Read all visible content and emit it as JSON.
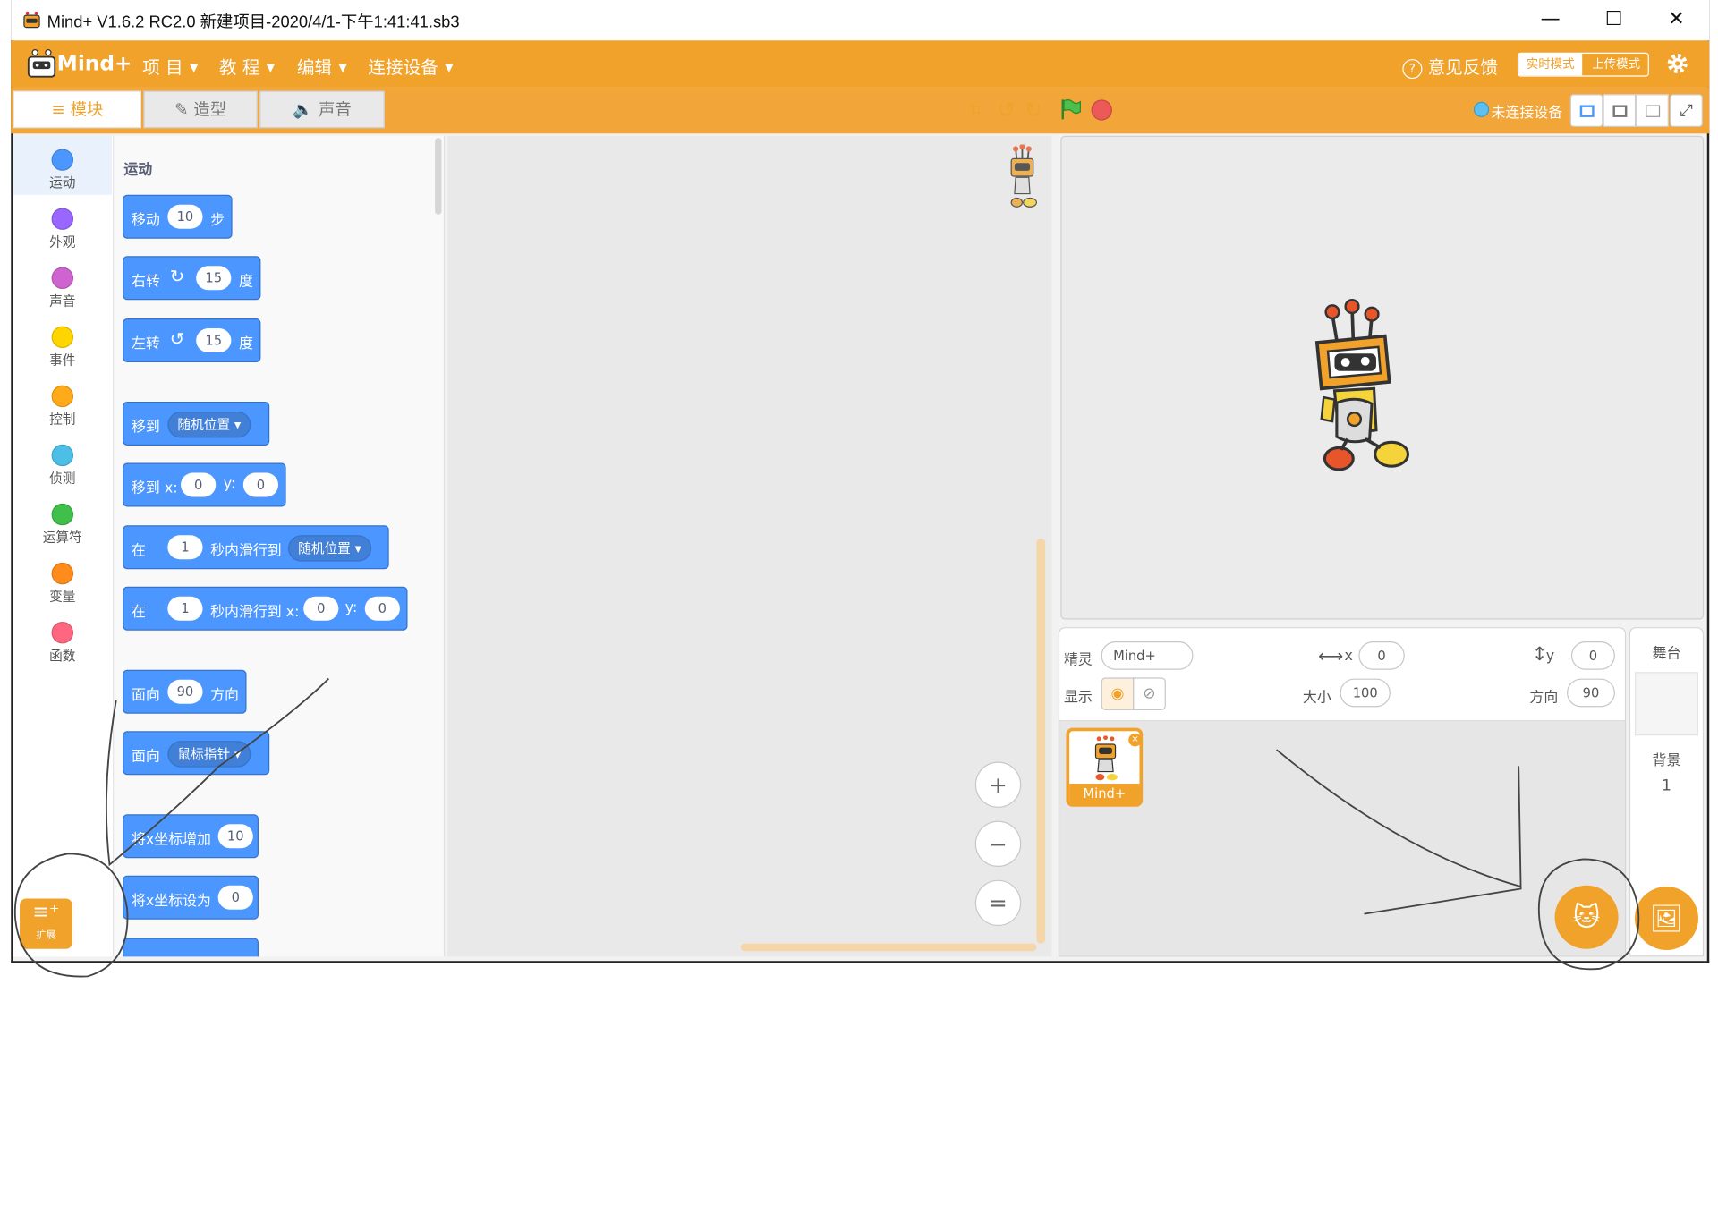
{
  "window": {
    "title": "Mind+ V1.6.2 RC2.0   新建项目-2020/4/1-下午1:41:41.sb3",
    "minimize": "—",
    "maximize": "☐",
    "close": "✕"
  },
  "menubar": {
    "logo": "Mind+",
    "items": [
      {
        "label": "项 目"
      },
      {
        "label": "教 程"
      },
      {
        "label": "编辑"
      },
      {
        "label": "连接设备"
      }
    ],
    "feedback": "意见反馈",
    "mode_realtime": "实时模式",
    "mode_upload": "上传模式"
  },
  "toolbar": {
    "tabs": [
      {
        "label": "模块"
      },
      {
        "label": "造型"
      },
      {
        "label": "声音"
      }
    ],
    "connection_status": "未连接设备"
  },
  "categories": [
    {
      "label": "运动",
      "color": "#4c97ff"
    },
    {
      "label": "外观",
      "color": "#9966ff"
    },
    {
      "label": "声音",
      "color": "#cf63cf"
    },
    {
      "label": "事件",
      "color": "#ffd500"
    },
    {
      "label": "控制",
      "color": "#ffab19"
    },
    {
      "label": "侦测",
      "color": "#4cbfe6"
    },
    {
      "label": "运算符",
      "color": "#40bf4a"
    },
    {
      "label": "变量",
      "color": "#ff8c1a"
    },
    {
      "label": "函数",
      "color": "#ff6680"
    }
  ],
  "palette": {
    "section_title": "运动",
    "blocks": {
      "move": {
        "label": "移动",
        "value": "10",
        "unit": "步"
      },
      "turn_right": {
        "label": "右转",
        "value": "15",
        "unit": "度"
      },
      "turn_left": {
        "label": "左转",
        "value": "15",
        "unit": "度"
      },
      "goto": {
        "label": "移到",
        "option": "随机位置"
      },
      "goto_xy": {
        "label": "移到 x:",
        "x": "0",
        "ylabel": "y:",
        "y": "0"
      },
      "glide": {
        "label": "在",
        "secs": "1",
        "mid": "秒内滑行到",
        "option": "随机位置"
      },
      "glide_xy": {
        "label": "在",
        "secs": "1",
        "mid": "秒内滑行到 x:",
        "x": "0",
        "ylabel": "y:",
        "y": "0"
      },
      "point_dir": {
        "label": "面向",
        "value": "90",
        "unit": "方向"
      },
      "point_towards": {
        "label": "面向",
        "option": "鼠标指针"
      },
      "change_x": {
        "label": "将x坐标增加",
        "value": "10"
      },
      "set_x": {
        "label": "将x坐标设为",
        "value": "0"
      }
    },
    "extension_label": "扩展"
  },
  "workspace": {
    "zoom_in": "+",
    "zoom_out": "−",
    "zoom_reset": "="
  },
  "sprite_info": {
    "sprite_label": "精灵",
    "sprite_name": "Mind+",
    "x_label": "x",
    "x_value": "0",
    "y_label": "y",
    "y_value": "0",
    "show_label": "显示",
    "size_label": "大小",
    "size_value": "100",
    "direction_label": "方向",
    "direction_value": "90"
  },
  "sprite_list": {
    "sprites": [
      {
        "name": "Mind+"
      }
    ]
  },
  "stage_pane": {
    "title": "舞台",
    "backdrop_label": "背景",
    "backdrop_count": "1"
  },
  "colors": {
    "brand_orange": "#f0a22a",
    "motion_blue": "#4c97ff"
  }
}
